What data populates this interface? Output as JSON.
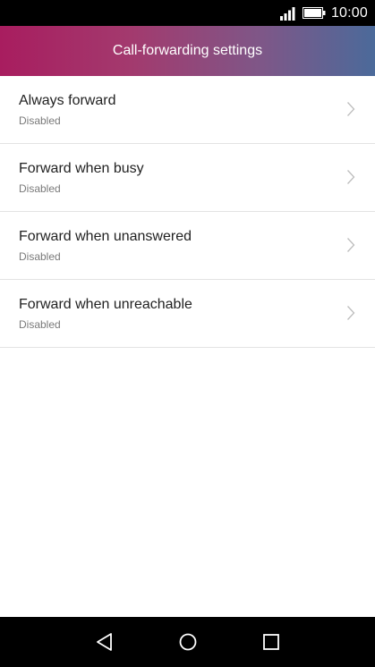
{
  "status_bar": {
    "time": "10:00",
    "signal_icon": "signal-strength-icon",
    "battery_icon": "battery-full-icon"
  },
  "header": {
    "title": "Call-forwarding settings",
    "gradient_colors": [
      "#a81d5f",
      "#4b6a9a"
    ]
  },
  "settings": {
    "items": [
      {
        "title": "Always forward",
        "status": "Disabled",
        "icon": "chevron-right-icon"
      },
      {
        "title": "Forward when busy",
        "status": "Disabled",
        "icon": "chevron-right-icon"
      },
      {
        "title": "Forward when unanswered",
        "status": "Disabled",
        "icon": "chevron-right-icon"
      },
      {
        "title": "Forward when unreachable",
        "status": "Disabled",
        "icon": "chevron-right-icon"
      }
    ]
  },
  "nav_bar": {
    "back_icon": "back-triangle-icon",
    "home_icon": "home-circle-icon",
    "recents_icon": "recents-square-icon"
  }
}
